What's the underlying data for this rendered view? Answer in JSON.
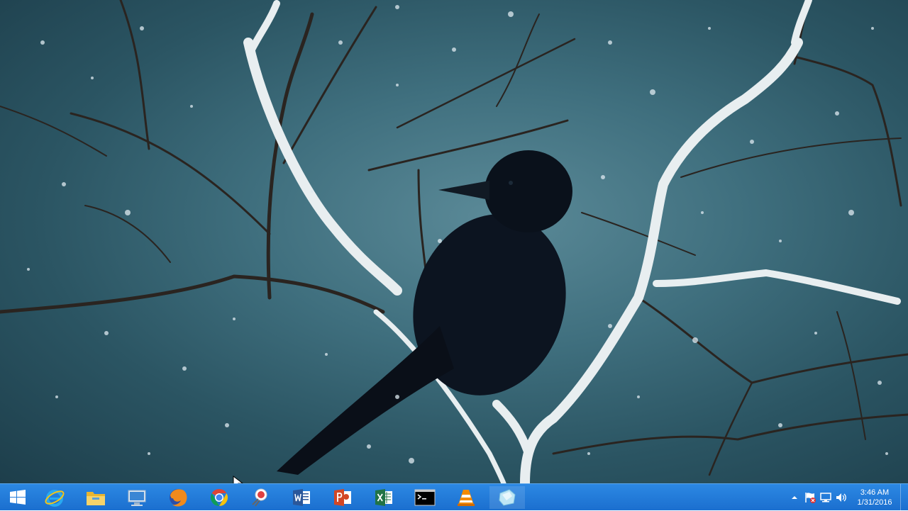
{
  "desktop": {
    "wallpaper": "raven-in-snowy-birch-tree",
    "background_color": "#3f6f7e"
  },
  "taskbar": {
    "color": "#1b6fcf",
    "start_icon": "windows-logo-icon",
    "apps": [
      {
        "name": "Internet Explorer",
        "icon": "internet-explorer-icon"
      },
      {
        "name": "File Explorer",
        "icon": "file-explorer-icon"
      },
      {
        "name": "Remote Desktop",
        "icon": "remote-desktop-icon"
      },
      {
        "name": "Firefox",
        "icon": "firefox-icon"
      },
      {
        "name": "Chrome",
        "icon": "chrome-icon"
      },
      {
        "name": "Snipping Tool",
        "icon": "snipping-tool-icon"
      },
      {
        "name": "Word",
        "icon": "word-icon"
      },
      {
        "name": "PowerPoint",
        "icon": "powerpoint-icon"
      },
      {
        "name": "Excel",
        "icon": "excel-icon"
      },
      {
        "name": "Command Prompt",
        "icon": "command-prompt-icon"
      },
      {
        "name": "VLC",
        "icon": "vlc-icon"
      },
      {
        "name": "Ice window",
        "icon": "ice-icon"
      }
    ]
  },
  "tray": {
    "icons": [
      "show-hidden-icons-icon",
      "action-center-flag-icon",
      "network-icon",
      "volume-icon"
    ],
    "time": "3:46 AM",
    "date": "1/31/2016"
  }
}
